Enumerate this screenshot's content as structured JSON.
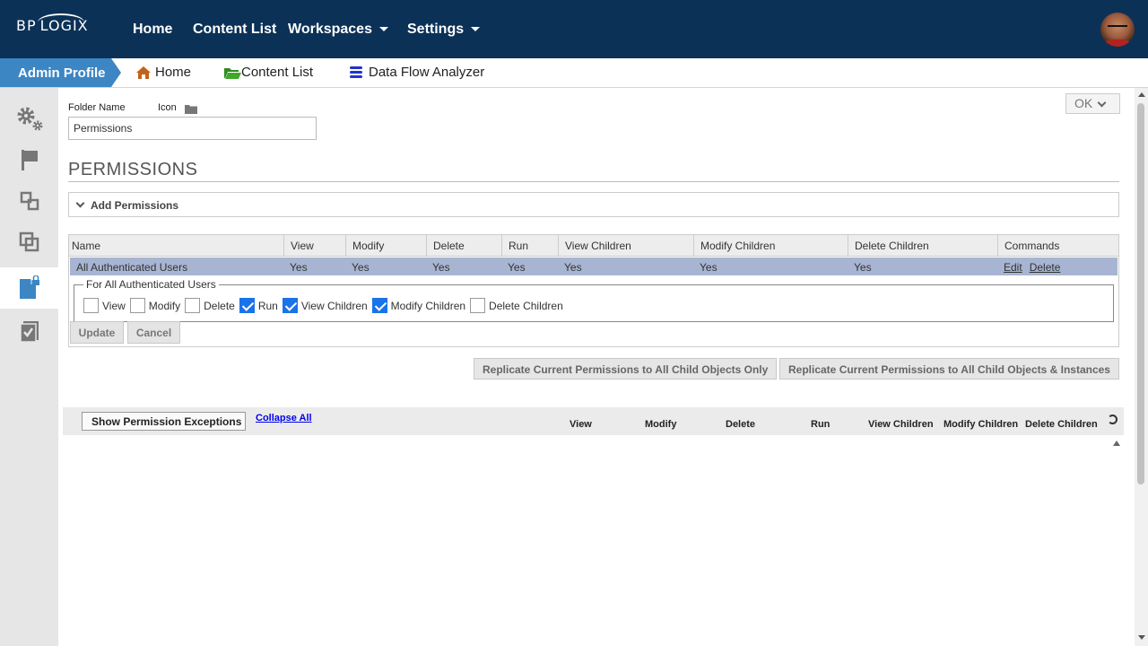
{
  "topnav": {
    "logo_left": "BP",
    "logo_right": "LOGIX",
    "items": [
      {
        "label": "Home"
      },
      {
        "label": "Content List"
      },
      {
        "label": "Workspaces"
      },
      {
        "label": "Settings"
      }
    ]
  },
  "subnav": {
    "admin_profile": "Admin Profile",
    "items": [
      {
        "label": "Home",
        "icon": "house-icon",
        "color": "#c4621a"
      },
      {
        "label": "Content List",
        "icon": "folder-open-icon",
        "color": "#2e8b1f"
      },
      {
        "label": "Data Flow Analyzer",
        "icon": "database-icon",
        "color": "#2233cc"
      }
    ]
  },
  "sidebar": {
    "items": [
      {
        "icon": "gears-icon"
      },
      {
        "icon": "flag-icon"
      },
      {
        "icon": "linked-squares-icon"
      },
      {
        "icon": "stacked-squares-icon"
      },
      {
        "icon": "permissions-doc-icon",
        "active": true
      },
      {
        "icon": "checklist-icon"
      }
    ]
  },
  "form": {
    "folder_name_label": "Folder Name",
    "icon_label": "Icon",
    "folder_name_value": "Permissions",
    "ok_label": "OK"
  },
  "permissions": {
    "title": "PERMISSIONS",
    "add_label": "Add Permissions",
    "columns": [
      "Name",
      "View",
      "Modify",
      "Delete",
      "Run",
      "View Children",
      "Modify Children",
      "Delete Children",
      "Commands"
    ],
    "row": {
      "name": "All Authenticated Users",
      "view": "Yes",
      "modify": "Yes",
      "delete": "Yes",
      "run": "Yes",
      "view_children": "Yes",
      "modify_children": "Yes",
      "delete_children": "Yes",
      "edit": "Edit",
      "delete_cmd": "Delete"
    },
    "editor": {
      "legend": "For All Authenticated Users",
      "checkboxes": [
        {
          "label": "View",
          "checked": false
        },
        {
          "label": "Modify",
          "checked": false
        },
        {
          "label": "Delete",
          "checked": false
        },
        {
          "label": "Run",
          "checked": true
        },
        {
          "label": "View Children",
          "checked": true
        },
        {
          "label": "Modify Children",
          "checked": true
        },
        {
          "label": "Delete Children",
          "checked": false
        }
      ],
      "update_label": "Update",
      "cancel_label": "Cancel"
    },
    "replicate_child_only": "Replicate Current Permissions to All Child Objects Only",
    "replicate_child_instances": "Replicate Current Permissions to All Child Objects & Instances"
  },
  "exceptions": {
    "show_label": "Show Permission Exceptions",
    "collapse_label": "Collapse All",
    "columns": [
      "View",
      "Modify",
      "Delete",
      "Run",
      "View Children",
      "Modify Children",
      "Delete Children"
    ]
  },
  "colors": {
    "topnav_bg": "#0b3157",
    "admin_tab": "#3c86c4",
    "selected_row": "#a7b5d2",
    "checkbox_on": "#1a73e8"
  }
}
